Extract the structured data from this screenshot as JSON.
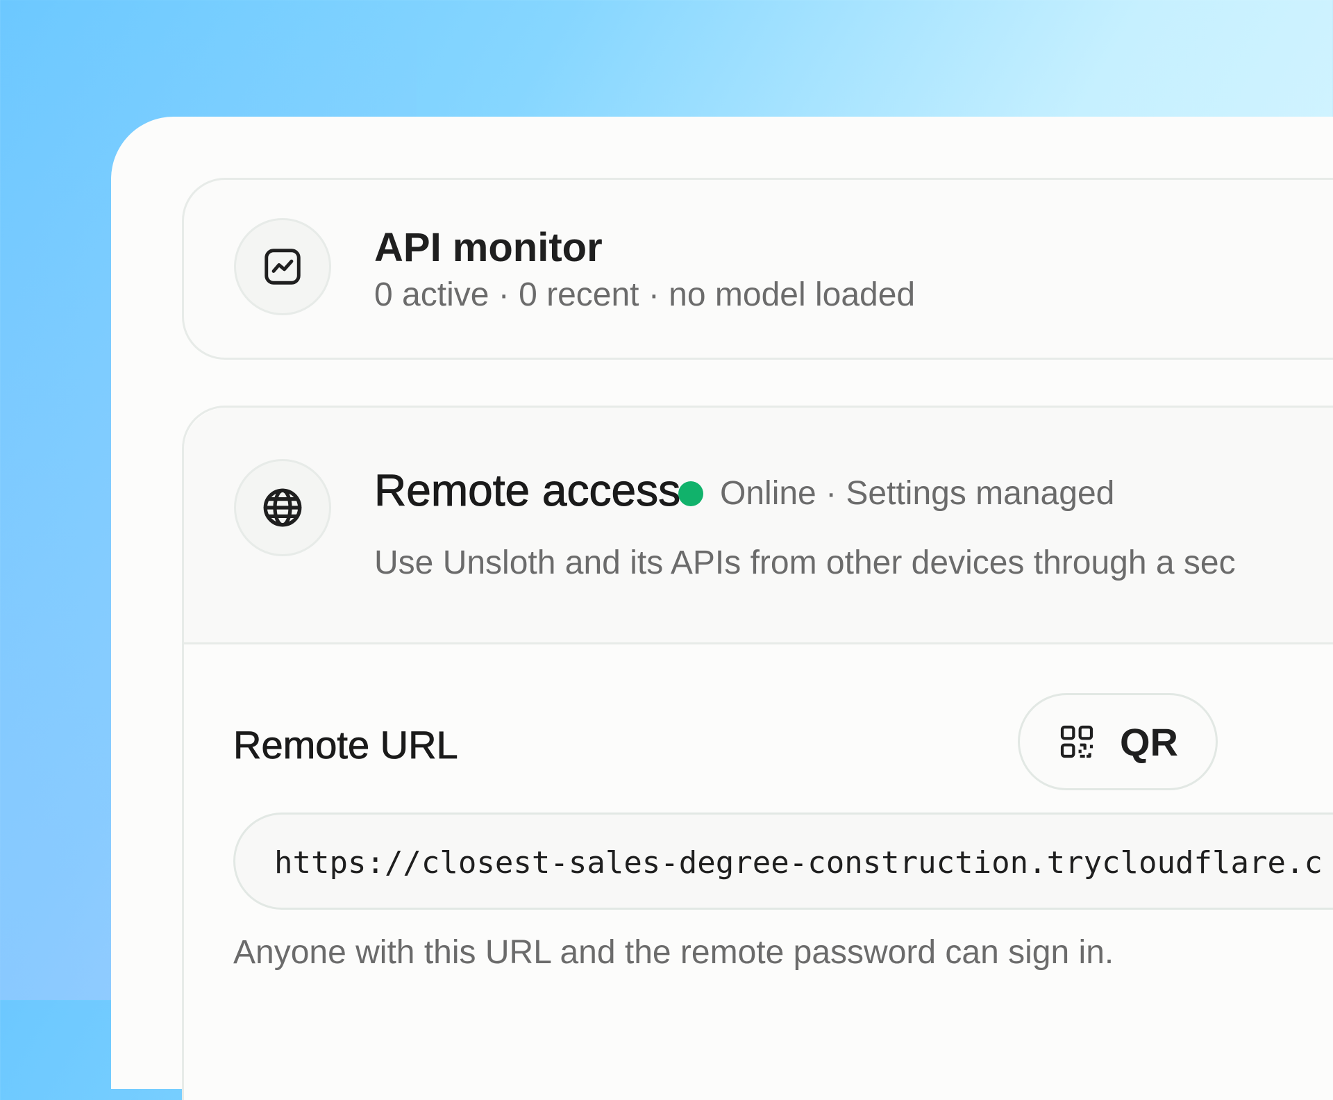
{
  "api_monitor": {
    "title": "API monitor",
    "subtitle": "0 active · 0 recent · no model loaded",
    "icon": "activity-chart-icon"
  },
  "remote_access": {
    "title": "Remote access",
    "status": "Online · Settings managed",
    "status_color": "#11b26b",
    "description": "Use Unsloth and its APIs from other devices through a sec",
    "icon": "globe-icon"
  },
  "remote_url": {
    "label": "Remote URL",
    "qr_label": "QR",
    "qr_icon": "qr-code-icon",
    "url": "https://closest-sales-degree-construction.trycloudflare.c",
    "note": "Anyone with this URL and the remote password can sign in."
  }
}
